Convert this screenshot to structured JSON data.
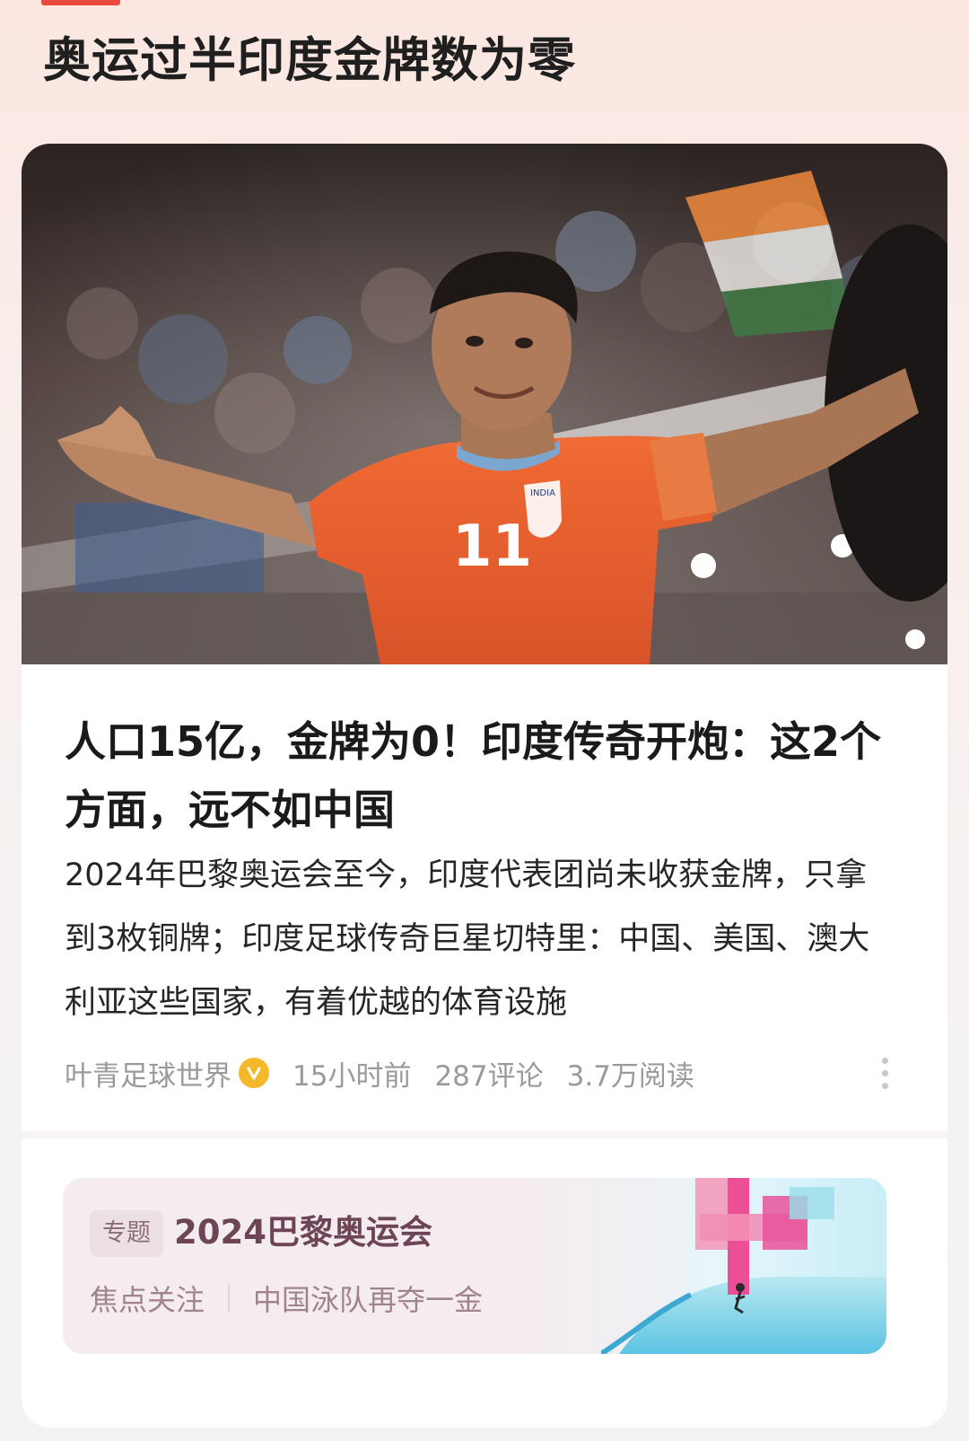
{
  "page": {
    "headline": "奥运过半印度金牌数为零"
  },
  "article": {
    "title": "人口15亿，金牌为0！印度传奇开炮：这2个方面，远不如中国",
    "summary": "2024年巴黎奥运会至今，印度代表团尚未收获金牌，只拿到3枚铜牌；印度足球传奇巨星切特里：中国、美国、澳大利亚这些国家，有着优越的体育设施",
    "author": "叶青足球世界",
    "verified_badge_icon": "verified-v-icon",
    "time": "15小时前",
    "comments": "287评论",
    "reads": "3.7万阅读",
    "image_icon": "footballer-celebration-photo",
    "jersey_number": "11",
    "crest_text": "INDIA"
  },
  "topic": {
    "tag": "专题",
    "title": "2024巴黎奥运会",
    "link_1": "焦点关注",
    "link_2": "中国泳队再夺一金"
  },
  "colors": {
    "accent_red": "#e94a3f",
    "verified_gold": "#f6b82b",
    "topic_title": "#6e4556",
    "jersey_orange": "#e4602c"
  }
}
